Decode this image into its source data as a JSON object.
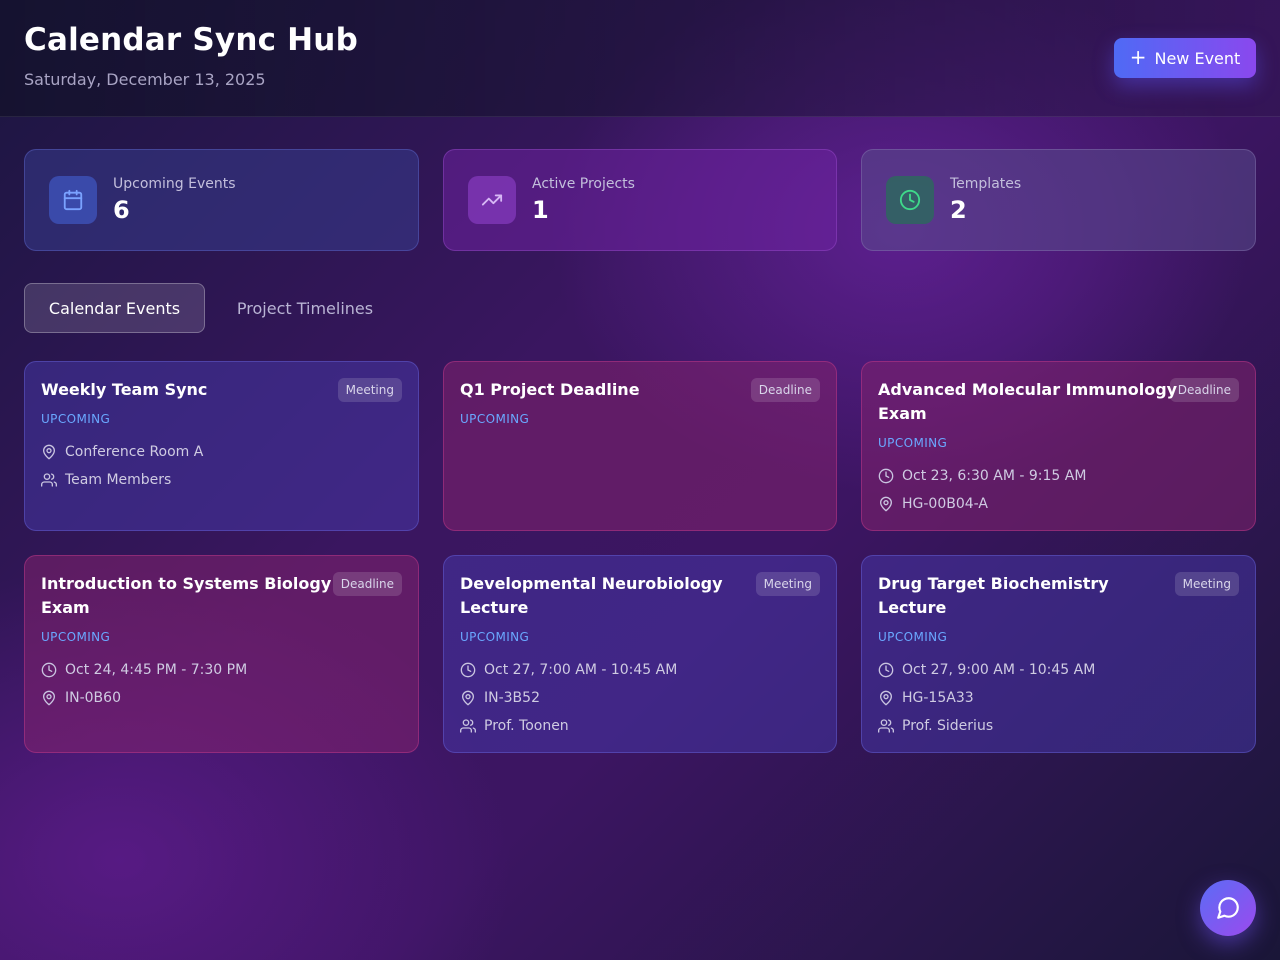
{
  "header": {
    "title": "Calendar Sync Hub",
    "date": "Saturday, December 13, 2025",
    "new_event_label": "New Event"
  },
  "stats": [
    {
      "label": "Upcoming Events",
      "value": "6",
      "icon": "calendar-icon"
    },
    {
      "label": "Active Projects",
      "value": "1",
      "icon": "trending-up-icon"
    },
    {
      "label": "Templates",
      "value": "2",
      "icon": "clock-icon"
    }
  ],
  "tabs": [
    {
      "label": "Calendar Events",
      "active": true
    },
    {
      "label": "Project Timelines",
      "active": false
    }
  ],
  "events": [
    {
      "title": "Weekly Team Sync",
      "badge": "Meeting",
      "status": "UPCOMING",
      "location": "Conference Room A",
      "people": "Team Members"
    },
    {
      "title": "Q1 Project Deadline",
      "badge": "Deadline",
      "status": "UPCOMING"
    },
    {
      "title": "Advanced Molecular Immunology Exam",
      "badge": "Deadline",
      "status": "UPCOMING",
      "time": "Oct 23, 6:30 AM - 9:15 AM",
      "location": "HG-00B04-A"
    },
    {
      "title": "Introduction to Systems Biology Exam",
      "badge": "Deadline",
      "status": "UPCOMING",
      "time": "Oct 24, 4:45 PM - 7:30 PM",
      "location": "IN-0B60"
    },
    {
      "title": "Developmental Neurobiology Lecture",
      "badge": "Meeting",
      "status": "UPCOMING",
      "time": "Oct 27, 7:00 AM - 10:45 AM",
      "location": "IN-3B52",
      "people": "Prof. Toonen"
    },
    {
      "title": "Drug Target Biochemistry Lecture",
      "badge": "Meeting",
      "status": "UPCOMING",
      "time": "Oct 27, 9:00 AM - 10:45 AM",
      "location": "HG-15A33",
      "people": "Prof. Siderius"
    }
  ],
  "colors": {
    "accent_start": "#4f6af5",
    "accent_end": "#8a48ee",
    "status_upcoming": "#6aa8ff"
  }
}
